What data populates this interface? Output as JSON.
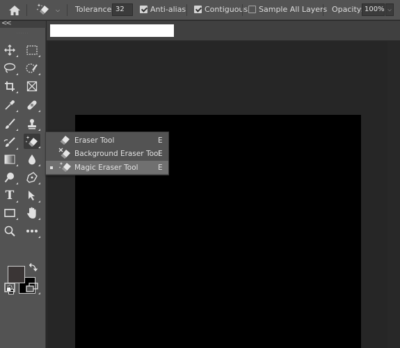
{
  "options_bar": {
    "tolerance_label": "Tolerance:",
    "tolerance_value": "32",
    "anti_alias_label": "Anti-alias",
    "anti_alias_checked": true,
    "contiguous_label": "Contiguous",
    "contiguous_checked": true,
    "sample_all_layers_label": "Sample All Layers",
    "sample_all_layers_checked": false,
    "opacity_label": "Opacity:",
    "opacity_value": "100%"
  },
  "toolbar": {
    "collapse_glyph": "<<",
    "grip_text": "......",
    "tools": [
      {
        "name": "move-tool",
        "icon": "move-icon"
      },
      {
        "name": "marquee-tool",
        "icon": "rect-marquee-icon"
      },
      {
        "name": "lasso-tool",
        "icon": "lasso-icon"
      },
      {
        "name": "quick-selection-tool",
        "icon": "quick-select-icon"
      },
      {
        "name": "crop-tool",
        "icon": "crop-icon"
      },
      {
        "name": "frame-tool",
        "icon": "frame-icon"
      },
      {
        "name": "eyedropper-tool",
        "icon": "eyedropper-icon"
      },
      {
        "name": "healing-brush-tool",
        "icon": "bandage-icon"
      },
      {
        "name": "brush-tool",
        "icon": "brush-icon"
      },
      {
        "name": "clone-stamp-tool",
        "icon": "stamp-icon"
      },
      {
        "name": "history-brush-tool",
        "icon": "history-brush-icon"
      },
      {
        "name": "eraser-tool",
        "icon": "magic-eraser-icon"
      },
      {
        "name": "gradient-tool",
        "icon": "gradient-icon"
      },
      {
        "name": "blur-tool",
        "icon": "drop-icon"
      },
      {
        "name": "dodge-tool",
        "icon": "dodge-icon"
      },
      {
        "name": "pen-tool",
        "icon": "pen-icon"
      },
      {
        "name": "type-tool",
        "icon": "type-icon"
      },
      {
        "name": "path-selection-tool",
        "icon": "arrow-icon"
      },
      {
        "name": "rectangle-tool",
        "icon": "rectangle-icon"
      },
      {
        "name": "hand-tool",
        "icon": "hand-icon"
      },
      {
        "name": "zoom-tool",
        "icon": "zoom-icon"
      },
      {
        "name": "more-tools",
        "icon": "ellipsis-icon"
      }
    ],
    "type_tool_glyph": "T",
    "foreground_color": "#3a3535",
    "background_color": "#000000"
  },
  "flyout": {
    "items": [
      {
        "label": "Eraser Tool",
        "shortcut": "E",
        "selected": false
      },
      {
        "label": "Background Eraser Tool",
        "shortcut": "E",
        "selected": false
      },
      {
        "label": "Magic Eraser Tool",
        "shortcut": "E",
        "selected": true
      }
    ]
  },
  "canvas": {
    "fill_color": "#000000"
  }
}
